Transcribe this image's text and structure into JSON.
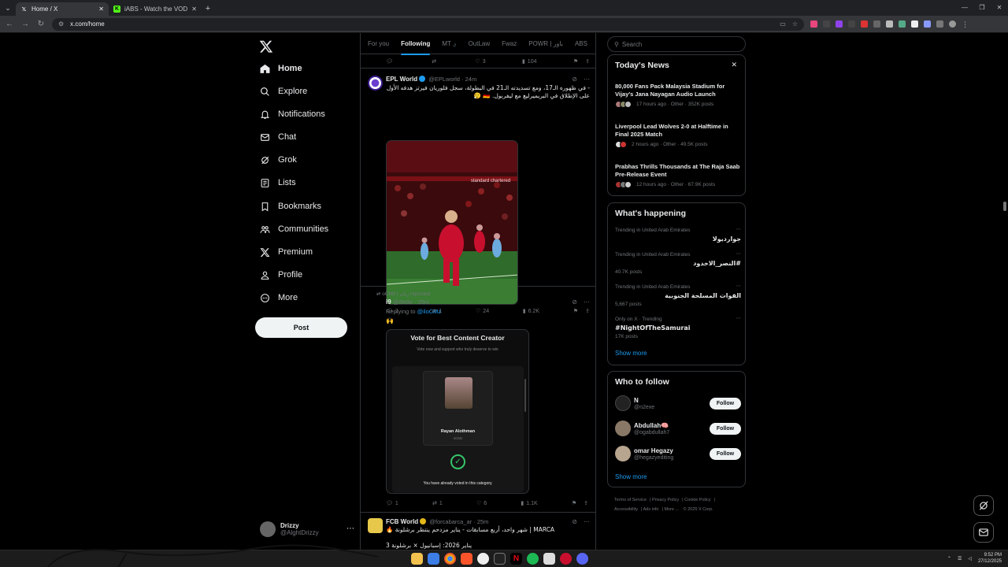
{
  "browser": {
    "tabs": [
      {
        "title": "Home / X",
        "active": true
      },
      {
        "title": "iABS - Watch the VOD on Kick",
        "active": false
      }
    ],
    "url": "x.com/home"
  },
  "nav": {
    "items": [
      {
        "label": "Home",
        "icon": "home-icon"
      },
      {
        "label": "Explore",
        "icon": "search-icon"
      },
      {
        "label": "Notifications",
        "icon": "bell-icon"
      },
      {
        "label": "Chat",
        "icon": "mail-icon"
      },
      {
        "label": "Grok",
        "icon": "grok-icon"
      },
      {
        "label": "Lists",
        "icon": "list-icon"
      },
      {
        "label": "Bookmarks",
        "icon": "bookmark-icon"
      },
      {
        "label": "Communities",
        "icon": "people-icon"
      },
      {
        "label": "Premium",
        "icon": "x-logo-icon"
      },
      {
        "label": "Profile",
        "icon": "person-icon"
      },
      {
        "label": "More",
        "icon": "more-circle-icon"
      }
    ],
    "post_label": "Post",
    "account": {
      "name": "Drizzy",
      "handle": "@AlghtDrizzy"
    }
  },
  "feed": {
    "tabs": [
      "For you",
      "Following",
      "MT",
      "OutLaw",
      "Fwaz",
      "POWR | باور",
      "ABS"
    ],
    "tab_mt_sub": "ي",
    "prev_actions": {
      "replies": "",
      "reposts": "",
      "likes": "3",
      "views": "104"
    },
    "tweet1": {
      "name": "EPL World",
      "handle": "@EPLworld",
      "time": "24m",
      "text": "- في ظهوره الـ17، ومع تسديدته الـ21 في البطولة، سجل فلوريان فيرتز هدفه الأول على الإطلاق في البريميرليغ مع ليفربول. 🇩🇪 😮‍💨",
      "media_banner": "standard chartered",
      "replies": "2",
      "reposts": "1",
      "likes": "24",
      "views": "6.2K"
    },
    "tweet2": {
      "repost_by": "oCMz | زيان reposted",
      "name": "i9",
      "handle": "@i9x9x",
      "time": "25m",
      "replying_label": "Replying to",
      "replying_to": "@iloCMz",
      "emoji": "🙌",
      "poll_title": "Vote for Best Content Creator",
      "poll_subtitle": "Vote now and support who truly deserve to win",
      "candidate_name": "Rayan Alothman",
      "candidate_handle": "oCMz",
      "voted_text": "You have already voted in this category.",
      "replies": "1",
      "reposts": "1",
      "likes": "6",
      "views": "1.1K"
    },
    "tweet3": {
      "name": "FCB World",
      "handle": "@forcabarca_ar",
      "time": "25m",
      "line1": "MARCA | شهر واحد، أربع مسابقات - يناير مزدحم ينتظر برشلونة 🔥",
      "line2": "يناير 2026: إسبانيول × برشلونة 3"
    }
  },
  "sidebar": {
    "search_placeholder": "Search",
    "news": {
      "title": "Today's News",
      "items": [
        {
          "title": "80,000 Fans Pack Malaysia Stadium for Vijay's Jana Nayagan Audio Launch",
          "meta": "17 hours ago · Other · 352K posts"
        },
        {
          "title": "Liverpool Lead Wolves 2-0 at Halftime in Final 2025 Match",
          "meta": "2 hours ago · Other · 49.5K posts"
        },
        {
          "title": "Prabhas Thrills Thousands at The Raja Saab Pre-Release Event",
          "meta": "12 hours ago · Other · 67.9K posts"
        }
      ]
    },
    "happening": {
      "title": "What's happening",
      "trends": [
        {
          "context": "Trending in United Arab Emirates",
          "name": "جواردیولا",
          "posts": ""
        },
        {
          "context": "Trending in United Arab Emirates",
          "name": "#النصر_الاخدود",
          "posts": "40.7K posts"
        },
        {
          "context": "Trending in United Arab Emirates",
          "name": "القوات المسلحة الجنوبية",
          "posts": "5,667 posts"
        },
        {
          "context": "Only on X · Trending",
          "name": "#NightOfTheSamurai",
          "posts": "17K posts"
        }
      ],
      "show_more": "Show more"
    },
    "who_to_follow": {
      "title": "Who to follow",
      "accounts": [
        {
          "name": "N",
          "handle": "@n2exe"
        },
        {
          "name": "Abdullah🧠",
          "handle": "@ogabdullah7"
        },
        {
          "name": "omar Hegazy",
          "handle": "@hegazyediting"
        }
      ],
      "follow_label": "Follow",
      "show_more": "Show more"
    },
    "footer": [
      "Terms of Service",
      "Privacy Policy",
      "Cookie Policy",
      "Accessibility",
      "Ads info",
      "More ...",
      "© 2025 X Corp."
    ]
  },
  "taskbar": {
    "time": "9:52 PM",
    "date": "27/12/2025"
  }
}
